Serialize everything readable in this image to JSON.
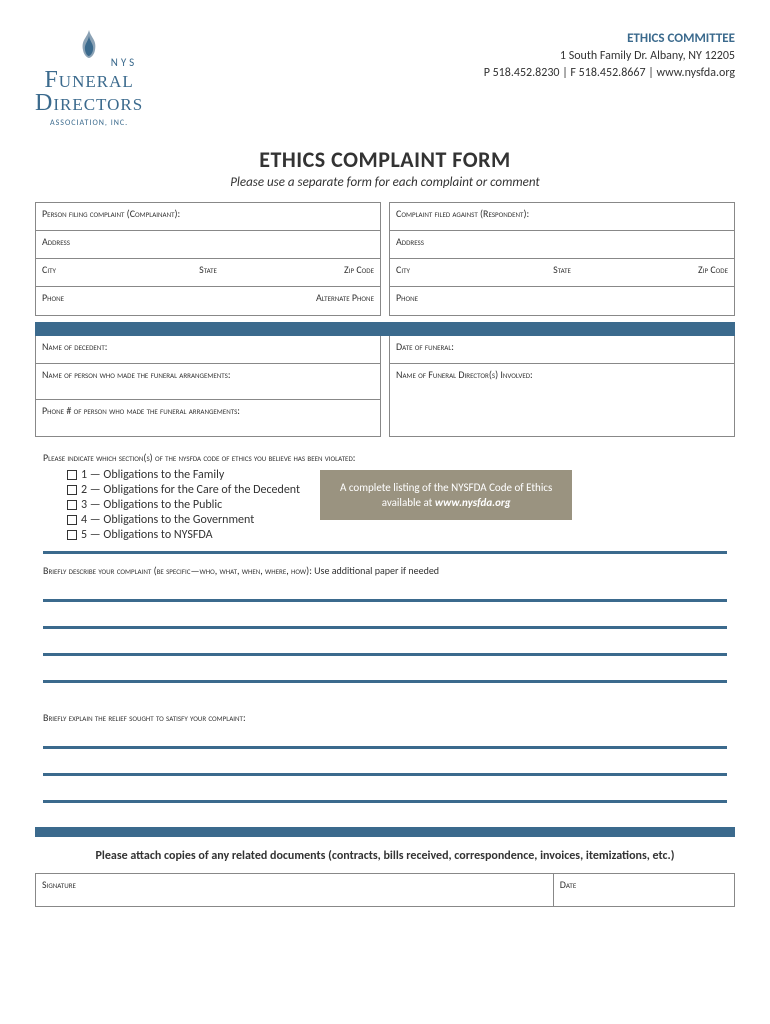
{
  "header": {
    "logo": {
      "nys": "NYS",
      "line1": "Funeral",
      "line2": "Directors",
      "sub": "ASSOCIATION, INC."
    },
    "committee": "ETHICS COMMITTEE",
    "address": "1 South Family Dr. Albany, NY 12205",
    "contact": "P 518.452.8230 | F 518.452.8667 | www.nysfda.org"
  },
  "title": "ETHICS COMPLAINT FORM",
  "subtitle": "Please use a separate form for each complaint or comment",
  "section1": {
    "left": {
      "complainant": "Person filing complaint (Complainant):",
      "address": "Address",
      "city": "City",
      "state": "State",
      "zip": "Zip Code",
      "phone": "Phone",
      "alt_phone": "Alternate Phone"
    },
    "right": {
      "respondent": "Complaint filed against (Respondent):",
      "address": "Address",
      "city": "City",
      "state": "State",
      "zip": "Zip Code",
      "phone": "Phone"
    }
  },
  "section2": {
    "left": {
      "decedent": "Name of decedent:",
      "arranger_name": "Name of person who made the funeral arrangements:",
      "arranger_phone": "Phone # of person who made the funeral arrangements:"
    },
    "right": {
      "funeral_date": "Date of funeral:",
      "director": "Name of Funeral Director(s) Involved:"
    }
  },
  "indicate": {
    "label": "Please indicate which section(s) of the nysfda code of ethics you believe has been violated:",
    "items": [
      "1 — Obligations to the Family",
      "2 — Obligations for the Care of the Decedent",
      "3 — Obligations to the Public",
      "4 — Obligations to the Government",
      "5 — Obligations to NYSFDA"
    ],
    "graybox": {
      "line1": "A complete listing of the NYSFDA Code of Ethics",
      "line2_prefix": "available at ",
      "line2_bold": "www.nysfda.org"
    }
  },
  "describe": {
    "label_caps": "Briefly describe your complaint (be specific—who, what, when, where, how): ",
    "label_normal": "Use additional paper if needed"
  },
  "relief": {
    "label": "Briefly explain the relief sought to satisfy your complaint:"
  },
  "attach_note": "Please attach copies of any related documents (contracts, bills received, correspondence, invoices, itemizations, etc.)",
  "signature": {
    "sig": "Signature",
    "date": "Date"
  }
}
